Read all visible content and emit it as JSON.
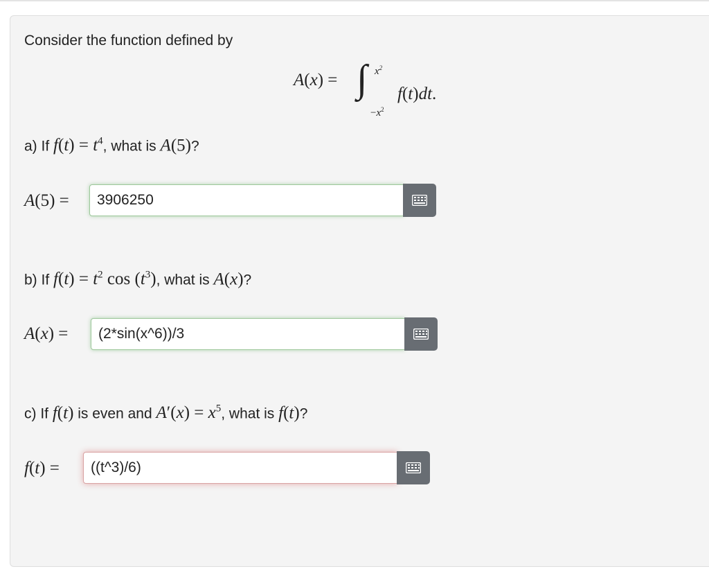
{
  "intro": "Consider the function defined by",
  "parts": [
    {
      "prefix": "a) If",
      "mid": ", what is",
      "end": "?",
      "answer": "3906250",
      "answer_state": "correct"
    },
    {
      "prefix": "b) If",
      "mid": ", what is",
      "end": "?",
      "answer": "(2*sin(x^6))/3",
      "answer_state": "correct"
    },
    {
      "prefix": "c) If",
      "mid": "is even and",
      "mid2": ", what is",
      "end": "?",
      "answer": "((t^3)/6)",
      "answer_state": "incorrect"
    }
  ],
  "keyboard_icon": "keyboard-icon",
  "colors": {
    "correct_border": "#9cc79a",
    "incorrect_border": "#d9a3a3",
    "button": "#686d73"
  }
}
